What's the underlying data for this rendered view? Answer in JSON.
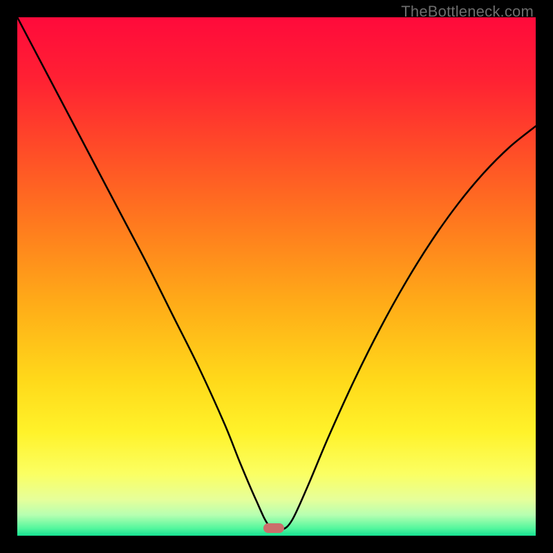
{
  "watermark": "TheBottleneck.com",
  "gradient": {
    "stops": [
      {
        "offset": 0.0,
        "color": "#ff0a3b"
      },
      {
        "offset": 0.12,
        "color": "#ff2133"
      },
      {
        "offset": 0.25,
        "color": "#ff4a28"
      },
      {
        "offset": 0.4,
        "color": "#ff7a1e"
      },
      {
        "offset": 0.55,
        "color": "#ffab18"
      },
      {
        "offset": 0.7,
        "color": "#ffd91a"
      },
      {
        "offset": 0.8,
        "color": "#fff22a"
      },
      {
        "offset": 0.88,
        "color": "#fbff62"
      },
      {
        "offset": 0.93,
        "color": "#e6ff9a"
      },
      {
        "offset": 0.96,
        "color": "#b7ffb1"
      },
      {
        "offset": 0.985,
        "color": "#56f79e"
      },
      {
        "offset": 1.0,
        "color": "#16e292"
      }
    ]
  },
  "marker": {
    "x_frac": 0.495,
    "y_frac": 0.985,
    "color": "#cb6e6b"
  },
  "chart_data": {
    "type": "line",
    "title": "",
    "xlabel": "",
    "ylabel": "",
    "xlim": [
      0,
      1
    ],
    "ylim": [
      0,
      1
    ],
    "legend": false,
    "grid": false,
    "series": [
      {
        "name": "bottleneck-curve",
        "x": [
          0.0,
          0.05,
          0.1,
          0.15,
          0.2,
          0.25,
          0.3,
          0.35,
          0.4,
          0.43,
          0.46,
          0.485,
          0.51,
          0.53,
          0.56,
          0.6,
          0.65,
          0.7,
          0.75,
          0.8,
          0.85,
          0.9,
          0.95,
          1.0
        ],
        "y": [
          1.0,
          0.905,
          0.81,
          0.715,
          0.62,
          0.525,
          0.425,
          0.325,
          0.215,
          0.14,
          0.07,
          0.02,
          0.012,
          0.03,
          0.095,
          0.19,
          0.3,
          0.4,
          0.49,
          0.57,
          0.64,
          0.7,
          0.75,
          0.79
        ]
      }
    ],
    "annotations": [
      {
        "type": "marker",
        "x": 0.495,
        "y": 0.015,
        "shape": "rounded-rect",
        "color": "#cb6e6b"
      }
    ]
  }
}
